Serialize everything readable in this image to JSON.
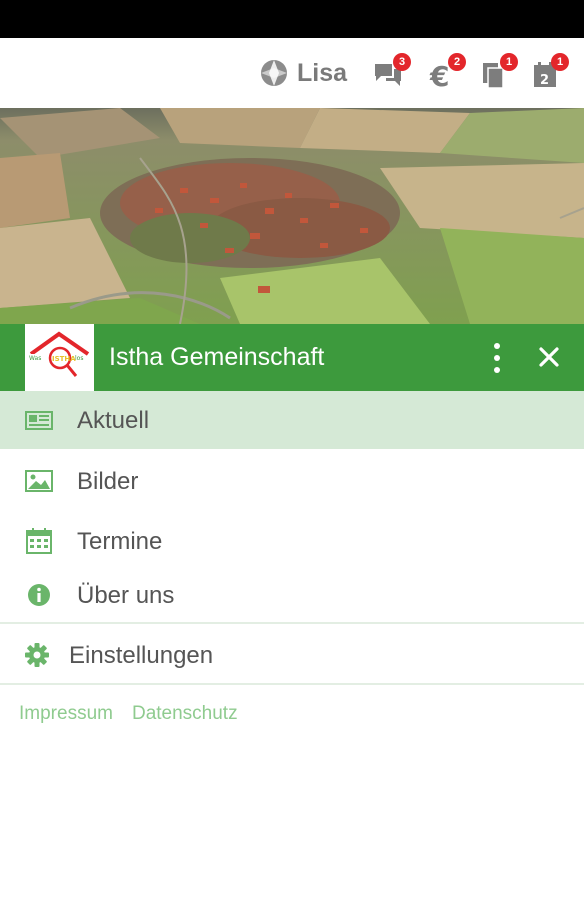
{
  "topbar": {
    "user_name": "Lisa",
    "icons": [
      {
        "name": "chat-icon",
        "badge": "3"
      },
      {
        "name": "euro-icon",
        "badge": "2"
      },
      {
        "name": "documents-icon",
        "badge": "1"
      },
      {
        "name": "calendar-icon",
        "badge": "1"
      }
    ]
  },
  "drawer": {
    "title": "Istha Gemeinschaft",
    "logo_text": "Was  ISTHA  los"
  },
  "menu": {
    "items": [
      {
        "label": "Aktuell",
        "icon": "newspaper-icon",
        "active": true
      },
      {
        "label": "Bilder",
        "icon": "image-icon",
        "active": false
      },
      {
        "label": "Termine",
        "icon": "calendar-grid-icon",
        "active": false
      },
      {
        "label": "Über uns",
        "icon": "info-icon",
        "active": false
      }
    ],
    "settings_label": "Einstellungen"
  },
  "footer": {
    "impressum": "Impressum",
    "datenschutz": "Datenschutz"
  },
  "colors": {
    "primary": "#3d9a3d",
    "active_bg": "#d5e9d6",
    "badge": "#e3262b",
    "icon_green": "#6ab56a"
  }
}
